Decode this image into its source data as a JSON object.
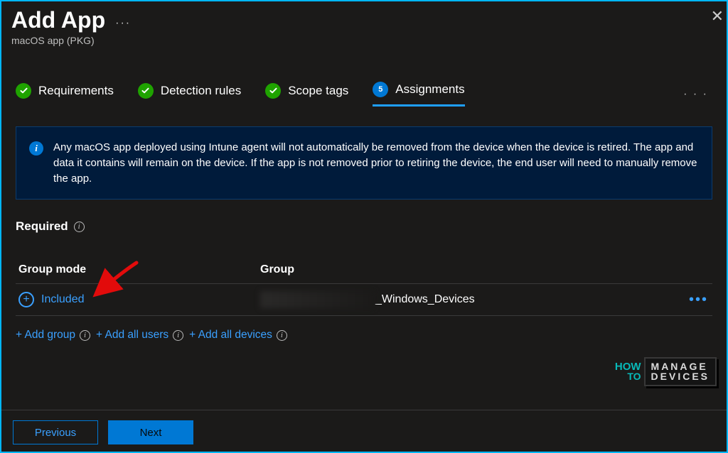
{
  "header": {
    "title": "Add App",
    "subtitle": "macOS app (PKG)"
  },
  "tabs": {
    "requirements": "Requirements",
    "detection": "Detection rules",
    "scope": "Scope tags",
    "assignments_num": "5",
    "assignments": "Assignments"
  },
  "banner": {
    "text": "Any macOS app deployed using Intune agent will not automatically be removed from the device when the device is retired. The app and data it contains will remain on the device. If the app is not removed prior to retiring the device, the end user will need to manually remove the app."
  },
  "section": {
    "required": "Required"
  },
  "table": {
    "col_mode": "Group mode",
    "col_group": "Group",
    "included_label": "Included",
    "group_suffix": "_Windows_Devices"
  },
  "add": {
    "group": "+ Add group",
    "all_users": "+ Add all users",
    "all_devices": "+ Add all devices"
  },
  "footer": {
    "previous": "Previous",
    "next": "Next"
  },
  "watermark": {
    "how": "HOW",
    "to": "TO",
    "line1": "MANAGE",
    "line2": "DEVICES"
  }
}
